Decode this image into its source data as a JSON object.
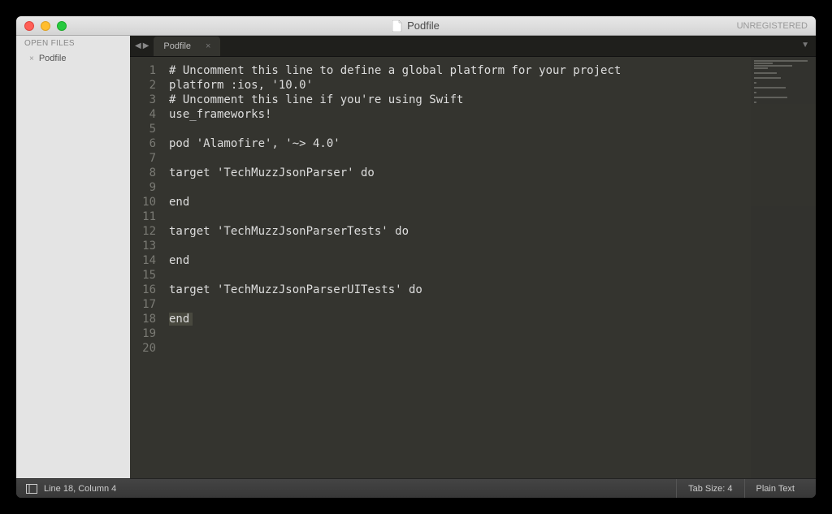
{
  "window": {
    "title": "Podfile",
    "registration": "UNREGISTERED"
  },
  "sidebar": {
    "header": "OPEN FILES",
    "files": [
      {
        "name": "Podfile"
      }
    ]
  },
  "tabs": {
    "active": {
      "label": "Podfile"
    }
  },
  "code": {
    "caret_line": 18,
    "caret_col": 4,
    "lines": [
      {
        "n": 1,
        "t": "# Uncomment this line to define a global platform for your project"
      },
      {
        "n": 2,
        "t": "platform :ios, '10.0'"
      },
      {
        "n": 3,
        "t": "# Uncomment this line if you're using Swift"
      },
      {
        "n": 4,
        "t": "use_frameworks!"
      },
      {
        "n": 5,
        "t": ""
      },
      {
        "n": 6,
        "t": "pod 'Alamofire', '~> 4.0'"
      },
      {
        "n": 7,
        "t": ""
      },
      {
        "n": 8,
        "t": "target 'TechMuzzJsonParser' do"
      },
      {
        "n": 9,
        "t": ""
      },
      {
        "n": 10,
        "t": "end"
      },
      {
        "n": 11,
        "t": ""
      },
      {
        "n": 12,
        "t": "target 'TechMuzzJsonParserTests' do"
      },
      {
        "n": 13,
        "t": ""
      },
      {
        "n": 14,
        "t": "end"
      },
      {
        "n": 15,
        "t": ""
      },
      {
        "n": 16,
        "t": "target 'TechMuzzJsonParserUITests' do"
      },
      {
        "n": 17,
        "t": ""
      },
      {
        "n": 18,
        "t": "end"
      },
      {
        "n": 19,
        "t": ""
      },
      {
        "n": 20,
        "t": ""
      }
    ]
  },
  "status": {
    "position": "Line 18, Column 4",
    "tab_size": "Tab Size: 4",
    "syntax": "Plain Text"
  }
}
